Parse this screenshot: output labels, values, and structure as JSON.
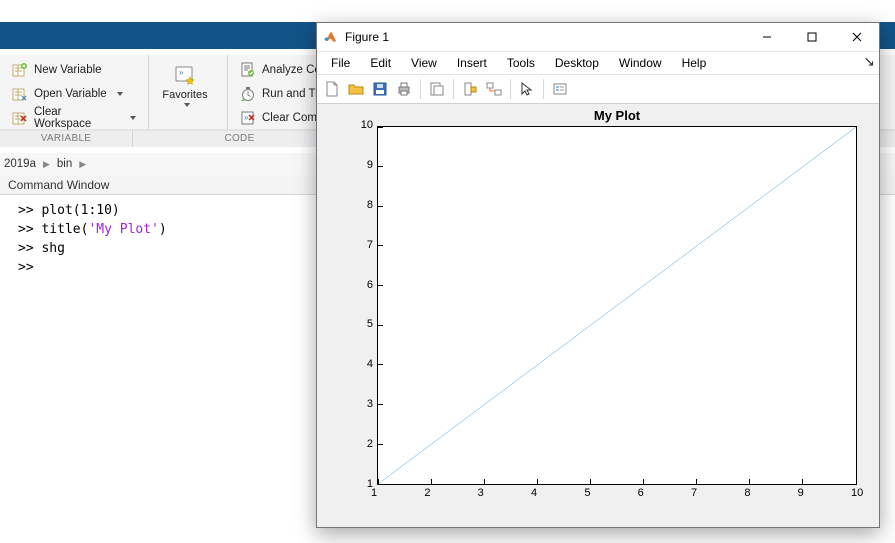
{
  "toolstrip": {
    "variable": {
      "label": "VARIABLE",
      "new_var": "New Variable",
      "open_var": "Open Variable",
      "clear_ws": "Clear Workspace"
    },
    "favorites": {
      "label": "Favorites"
    },
    "code": {
      "label": "CODE",
      "analyze": "Analyze Code",
      "runtime": "Run and Time",
      "clear": "Clear Commands"
    }
  },
  "address": {
    "seg1": "2019a",
    "seg2": "bin"
  },
  "command_window": {
    "title": "Command Window",
    "lines": [
      {
        "prompt": ">> ",
        "text": "plot(1:10)"
      },
      {
        "prompt": ">> ",
        "text_pre": "title(",
        "str": "'My Plot'",
        "text_post": ")"
      },
      {
        "prompt": ">> ",
        "text": "shg"
      },
      {
        "prompt": ">> ",
        "text": ""
      }
    ]
  },
  "figure": {
    "title": "Figure 1",
    "menu": [
      "File",
      "Edit",
      "View",
      "Insert",
      "Tools",
      "Desktop",
      "Window",
      "Help"
    ],
    "toolbar_icons": [
      "new-file-icon",
      "open-folder-icon",
      "save-icon",
      "print-icon",
      "page-setup-icon",
      "data-cursor-icon",
      "link-plots-icon",
      "pointer-icon",
      "insert-legend-icon"
    ]
  },
  "chart_data": {
    "type": "line",
    "title": "My Plot",
    "x": [
      1,
      2,
      3,
      4,
      5,
      6,
      7,
      8,
      9,
      10
    ],
    "values": [
      1,
      2,
      3,
      4,
      5,
      6,
      7,
      8,
      9,
      10
    ],
    "xlim": [
      1,
      10
    ],
    "ylim": [
      1,
      10
    ],
    "xticks": [
      1,
      2,
      3,
      4,
      5,
      6,
      7,
      8,
      9,
      10
    ],
    "yticks": [
      1,
      2,
      3,
      4,
      5,
      6,
      7,
      8,
      9,
      10
    ],
    "xlabel": "",
    "ylabel": ""
  }
}
